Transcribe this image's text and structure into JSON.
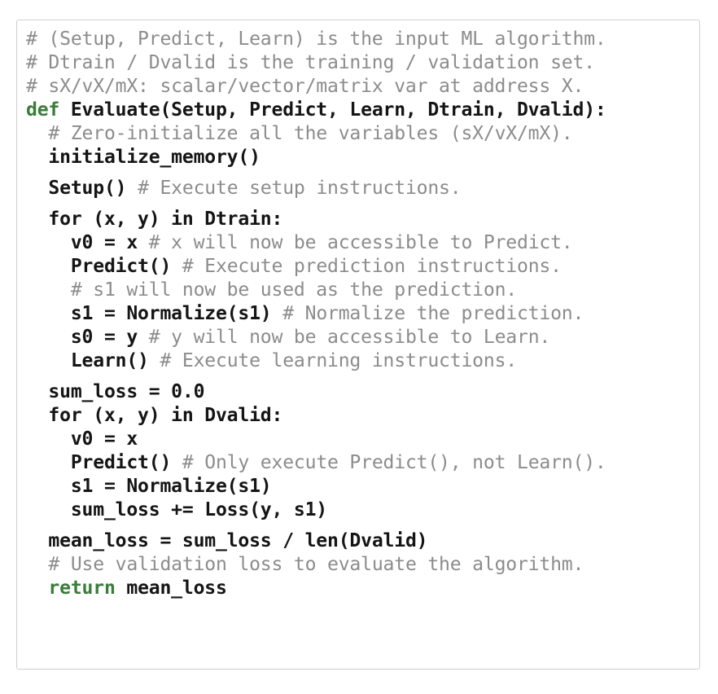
{
  "figure": {
    "kind": "code-listing",
    "language": "python",
    "border_color": "#cfcfcf",
    "background_color": "#ffffff",
    "colors": {
      "keyword": "#3a7d3a",
      "comment": "#8c8c8c",
      "code": "#151515"
    },
    "lines": [
      {
        "id": "line-1",
        "indent": 0,
        "gap_before": false,
        "tokens": [
          {
            "type": "comment",
            "text": "# (Setup, Predict, Learn) is the input ML algorithm."
          }
        ]
      },
      {
        "id": "line-2",
        "indent": 0,
        "gap_before": false,
        "tokens": [
          {
            "type": "comment",
            "text": "# Dtrain / Dvalid is the training / validation set."
          }
        ]
      },
      {
        "id": "line-3",
        "indent": 0,
        "gap_before": false,
        "tokens": [
          {
            "type": "comment",
            "text": "# sX/vX/mX: scalar/vector/matrix var at address X."
          }
        ]
      },
      {
        "id": "line-4",
        "indent": 0,
        "gap_before": false,
        "tokens": [
          {
            "type": "keyword",
            "text": "def"
          },
          {
            "type": "code",
            "text": " Evaluate(Setup, Predict, Learn, Dtrain, Dvalid):"
          }
        ]
      },
      {
        "id": "line-5",
        "indent": 1,
        "gap_before": false,
        "tokens": [
          {
            "type": "comment",
            "text": "# Zero-initialize all the variables (sX/vX/mX)."
          }
        ]
      },
      {
        "id": "line-6",
        "indent": 1,
        "gap_before": false,
        "tokens": [
          {
            "type": "code",
            "text": "initialize_memory()"
          }
        ]
      },
      {
        "id": "line-7",
        "indent": 1,
        "gap_before": true,
        "tokens": [
          {
            "type": "code",
            "text": "Setup()"
          },
          {
            "type": "comment",
            "text": " # Execute setup instructions."
          }
        ]
      },
      {
        "id": "line-8",
        "indent": 1,
        "gap_before": true,
        "tokens": [
          {
            "type": "code",
            "text": "for (x, y) in Dtrain:"
          }
        ]
      },
      {
        "id": "line-9",
        "indent": 2,
        "gap_before": false,
        "tokens": [
          {
            "type": "code",
            "text": "v0 = x"
          },
          {
            "type": "comment",
            "text": " # x will now be accessible to Predict."
          }
        ]
      },
      {
        "id": "line-10",
        "indent": 2,
        "gap_before": false,
        "tokens": [
          {
            "type": "code",
            "text": "Predict()"
          },
          {
            "type": "comment",
            "text": " # Execute prediction instructions."
          }
        ]
      },
      {
        "id": "line-11",
        "indent": 2,
        "gap_before": false,
        "tokens": [
          {
            "type": "comment",
            "text": "# s1 will now be used as the prediction."
          }
        ]
      },
      {
        "id": "line-12",
        "indent": 2,
        "gap_before": false,
        "tokens": [
          {
            "type": "code",
            "text": "s1 = Normalize(s1)"
          },
          {
            "type": "comment",
            "text": " # Normalize the prediction."
          }
        ]
      },
      {
        "id": "line-13",
        "indent": 2,
        "gap_before": false,
        "tokens": [
          {
            "type": "code",
            "text": "s0 = y"
          },
          {
            "type": "comment",
            "text": " # y will now be accessible to Learn."
          }
        ]
      },
      {
        "id": "line-14",
        "indent": 2,
        "gap_before": false,
        "tokens": [
          {
            "type": "code",
            "text": "Learn()"
          },
          {
            "type": "comment",
            "text": " # Execute learning instructions."
          }
        ]
      },
      {
        "id": "line-15",
        "indent": 1,
        "gap_before": true,
        "tokens": [
          {
            "type": "code",
            "text": "sum_loss = 0.0"
          }
        ]
      },
      {
        "id": "line-16",
        "indent": 1,
        "gap_before": false,
        "tokens": [
          {
            "type": "code",
            "text": "for (x, y) in Dvalid:"
          }
        ]
      },
      {
        "id": "line-17",
        "indent": 2,
        "gap_before": false,
        "tokens": [
          {
            "type": "code",
            "text": "v0 = x"
          }
        ]
      },
      {
        "id": "line-18",
        "indent": 2,
        "gap_before": false,
        "tokens": [
          {
            "type": "code",
            "text": "Predict()"
          },
          {
            "type": "comment",
            "text": " # Only execute Predict(), not Learn()."
          }
        ]
      },
      {
        "id": "line-19",
        "indent": 2,
        "gap_before": false,
        "tokens": [
          {
            "type": "code",
            "text": "s1 = Normalize(s1)"
          }
        ]
      },
      {
        "id": "line-20",
        "indent": 2,
        "gap_before": false,
        "tokens": [
          {
            "type": "code",
            "text": "sum_loss += Loss(y, s1)"
          }
        ]
      },
      {
        "id": "line-21",
        "indent": 1,
        "gap_before": true,
        "tokens": [
          {
            "type": "code",
            "text": "mean_loss = sum_loss / len(Dvalid)"
          }
        ]
      },
      {
        "id": "line-22",
        "indent": 1,
        "gap_before": false,
        "tokens": [
          {
            "type": "comment",
            "text": "# Use validation loss to evaluate the algorithm."
          }
        ]
      },
      {
        "id": "line-23",
        "indent": 1,
        "gap_before": false,
        "tokens": [
          {
            "type": "keyword",
            "text": "return"
          },
          {
            "type": "code",
            "text": " mean_loss"
          }
        ]
      }
    ]
  }
}
